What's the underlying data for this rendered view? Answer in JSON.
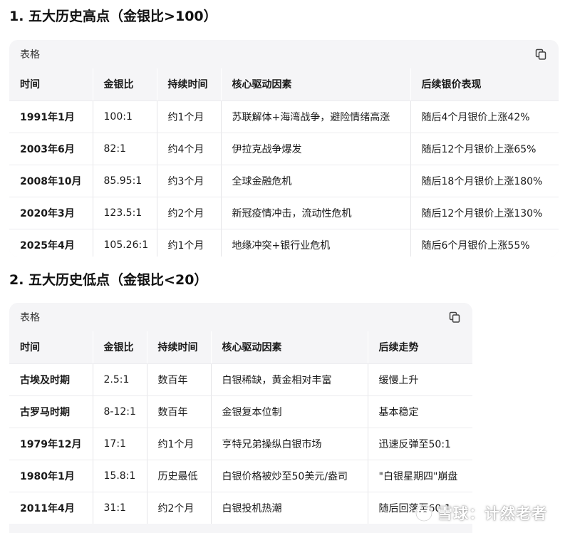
{
  "sections": [
    {
      "heading": "1. 五大历史高点（金银比>100）",
      "card_label": "表格",
      "columns": [
        "时间",
        "金银比",
        "持续时间",
        "核心驱动因素",
        "后续银价表现"
      ],
      "rows": [
        [
          "1991年1月",
          "100:1",
          "约1个月",
          "苏联解体+海湾战争，避险情绪高涨",
          "随后4个月银价上涨42%"
        ],
        [
          "2003年6月",
          "82:1",
          "约4个月",
          "伊拉克战争爆发",
          "随后12个月银价上涨65%"
        ],
        [
          "2008年10月",
          "85.95:1",
          "约3个月",
          "全球金融危机",
          "随后18个月银价上涨180%"
        ],
        [
          "2020年3月",
          "123.5:1",
          "约2个月",
          "新冠疫情冲击，流动性危机",
          "随后12个月银价上涨130%"
        ],
        [
          "2025年4月",
          "105.26:1",
          "约1个月",
          "地缘冲突+银行业危机",
          "随后6个月银价上涨55%"
        ]
      ]
    },
    {
      "heading": "2. 五大历史低点（金银比<20）",
      "card_label": "表格",
      "columns": [
        "时间",
        "金银比",
        "持续时间",
        "核心驱动因素",
        "后续走势"
      ],
      "rows": [
        [
          "古埃及时期",
          "2.5:1",
          "数百年",
          "白银稀缺，黄金相对丰富",
          "缓慢上升"
        ],
        [
          "古罗马时期",
          "8-12:1",
          "数百年",
          "金银复本位制",
          "基本稳定"
        ],
        [
          "1979年12月",
          "17:1",
          "约1个月",
          "亨特兄弟操纵白银市场",
          "迅速反弹至50:1"
        ],
        [
          "1980年1月",
          "15.8:1",
          "历史最低",
          "白银价格被炒至50美元/盎司",
          "\"白银星期四\"崩盘"
        ],
        [
          "2011年4月",
          "31:1",
          "约2个月",
          "白银投机热潮",
          "随后回落至60:1"
        ]
      ]
    }
  ],
  "watermark": {
    "text": "雪球：计然老者"
  }
}
